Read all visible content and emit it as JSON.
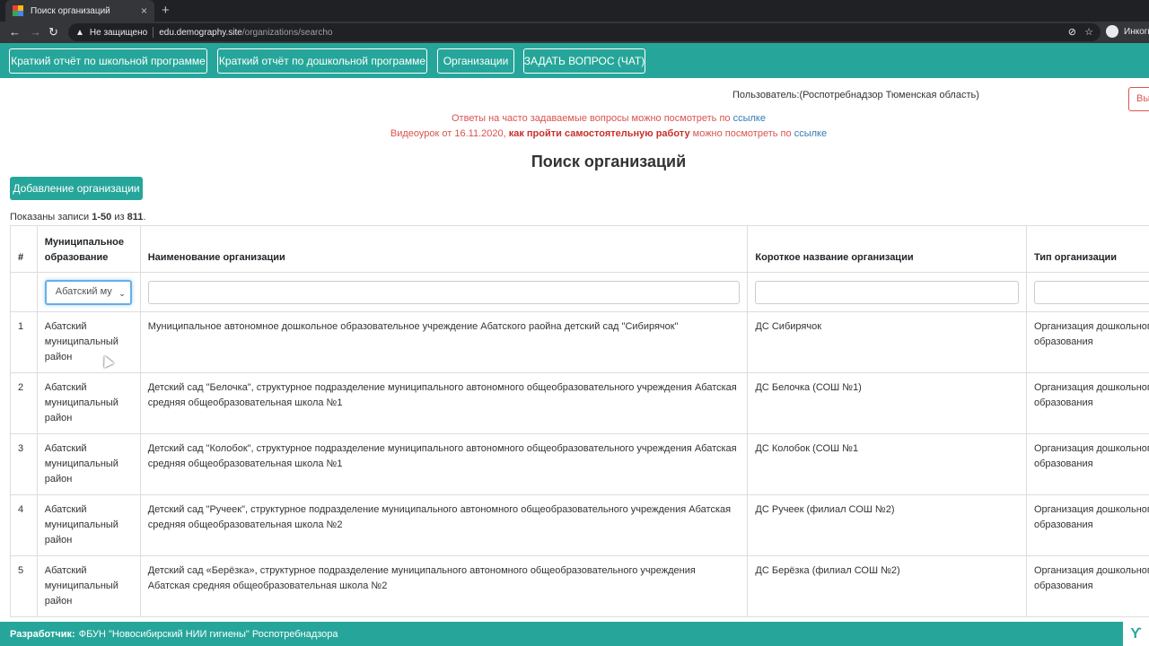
{
  "browser": {
    "tab_title": "Поиск организаций",
    "close_glyph": "×",
    "new_tab_glyph": "+",
    "not_secure": "Не защищено",
    "url_host": "edu.demography.site",
    "url_path": "/organizations/searcho",
    "profile_label": "Инкогн",
    "icons": [
      "back-icon",
      "forward-icon",
      "reload-icon",
      "warning-icon",
      "incognito-eye-icon",
      "star-icon"
    ]
  },
  "topnav": {
    "buttons": [
      "Краткий отчёт по школьной программе",
      "Краткий отчёт по дошкольной программе",
      "Организации",
      "ЗАДАТЬ ВОПРОС (ЧАТ)"
    ],
    "color": "#26a69a"
  },
  "user": {
    "label": "Пользователь:(Роспотребнадзор Тюменская область)",
    "logout": "Выход"
  },
  "notice": {
    "line1_text": "Ответы на часто задаваемые вопросы можно посмотреть по ",
    "line1_link": "ссылке",
    "line2_pre": "Видеоурок от 16.11.2020, ",
    "line2_bold": "как пройти самостоятельную работу",
    "line2_post": " можно посмотреть по ",
    "line2_link": "ссылке"
  },
  "page": {
    "title": "Поиск организаций",
    "add_button": "Добавление организации",
    "summary_pre": "Показаны записи ",
    "summary_range": "1-50",
    "summary_mid": " из ",
    "summary_total": "811",
    "summary_end": "."
  },
  "table": {
    "headers": [
      "#",
      "Муниципальное образование",
      "Наименование организации",
      "Короткое название организации",
      "Тип организации"
    ],
    "filter_select_value": "Абатский му",
    "rows": [
      {
        "num": "1",
        "municipality": "Абатский муниципальный район",
        "name": "Муниципальное автономное дошкольное образовательное учреждение Абатского раойна детский сад \"Сибирячок\"",
        "short": "ДС Сибирячок",
        "type": "Организация дошкольного образования"
      },
      {
        "num": "2",
        "municipality": "Абатский муниципальный район",
        "name": "Детский сад \"Белочка\", структурное подразделение муниципального автономного общеобразовательного учреждения Абатская средняя общеобразовательная школа №1",
        "short": "ДС Белочка (СОШ №1)",
        "type": "Организация дошкольного образования"
      },
      {
        "num": "3",
        "municipality": "Абатский муниципальный район",
        "name": "Детский сад \"Колобок\", структурное подразделение муниципального автономного общеобразовательного учреждения Абатская средняя общеобразовательная школа №1",
        "short": "ДС Колобок (СОШ №1",
        "type": "Организация дошкольного образования"
      },
      {
        "num": "4",
        "municipality": "Абатский муниципальный район",
        "name": "Детский сад \"Ручеек\", структурное подразделение муниципального автономного общеобразовательного учреждения Абатская средняя общеобразовательная школа №2",
        "short": "ДС Ручеек (филиал СОШ №2)",
        "type": "Организация дошкольного образования"
      },
      {
        "num": "5",
        "municipality": "Абатский муниципальный район",
        "name": "Детский сад «Берёзка», структурное подразделение муниципального автономного общеобразовательного учреждения Абатская средняя общеобразовательная школа №2",
        "short": "ДС Берёзка (филиал СОШ №2)",
        "type": "Организация дошкольного образования"
      }
    ]
  },
  "footer": {
    "label": "Разработчик:",
    "text": "ФБУН \"Новосибирский НИИ гигиены\" Роспотребнадзора"
  }
}
